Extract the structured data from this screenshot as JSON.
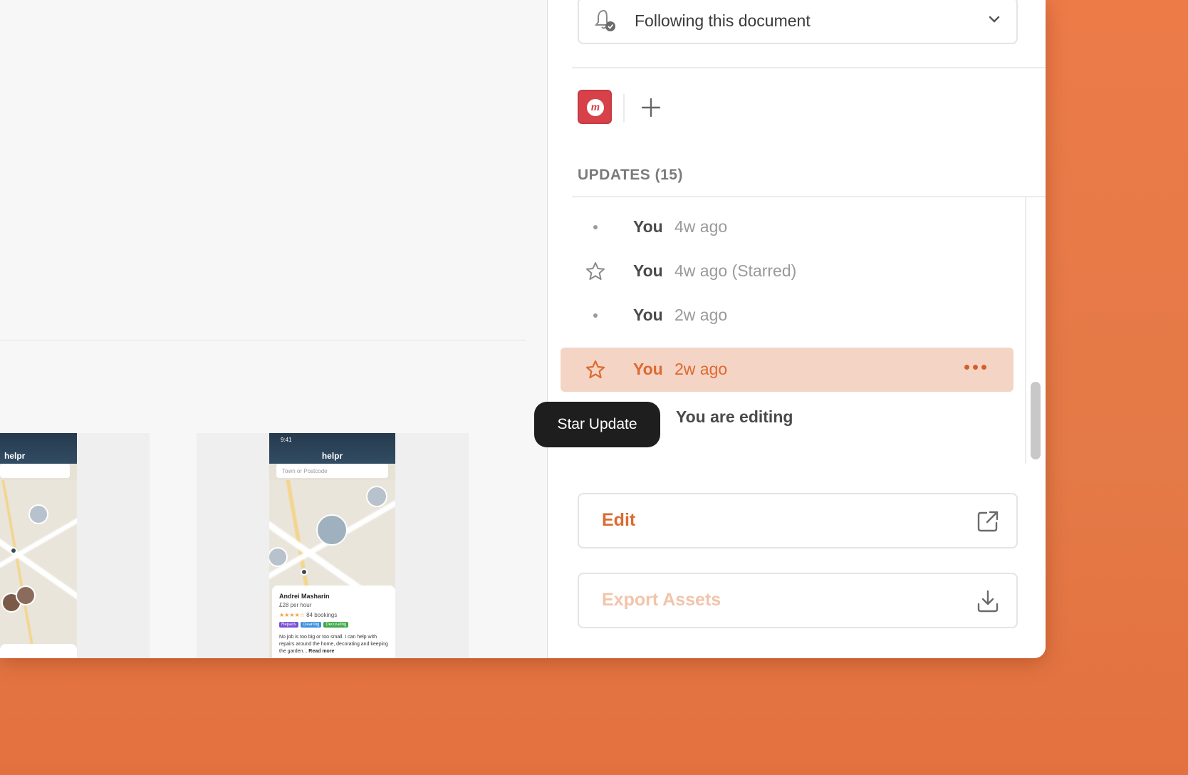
{
  "follow": {
    "label": "Following this document",
    "icon": "bell-check-icon"
  },
  "integrations": {
    "app_icon_letter": "m",
    "app_color": "#d7424a"
  },
  "updates": {
    "title": "UPDATES (15)",
    "items": [
      {
        "marker": "dot",
        "author": "You",
        "time": "4w ago",
        "active": false
      },
      {
        "marker": "star",
        "author": "You",
        "time": "4w ago (Starred)",
        "active": false
      },
      {
        "marker": "dot",
        "author": "You",
        "time": "2w ago",
        "active": false
      },
      {
        "marker": "star",
        "author": "You",
        "time": "2w ago",
        "active": true
      }
    ],
    "editing_label": "You are editing"
  },
  "tooltip": {
    "label": "Star Update"
  },
  "actions": {
    "edit_label": "Edit",
    "export_label": "Export Assets"
  },
  "colors": {
    "accent": "#dd6a31",
    "active_row": "#f4d4c4",
    "tooltip_bg": "#1e1e1e"
  },
  "canvas": {
    "phone1": {
      "title": "helpr"
    },
    "phone2": {
      "time": "9:41",
      "title": "helpr",
      "search_placeholder": "Town or Postcode",
      "card_name": "Andrei Masharin",
      "card_rate": "£28 per hour",
      "card_bookings": "84 bookings",
      "tags": [
        "Repairs",
        "Cleaning",
        "Decorating"
      ],
      "bio": "No job is too big or too small. I can help with repairs around the home, decorating and keeping the garden...",
      "read_more": "Read more"
    }
  }
}
